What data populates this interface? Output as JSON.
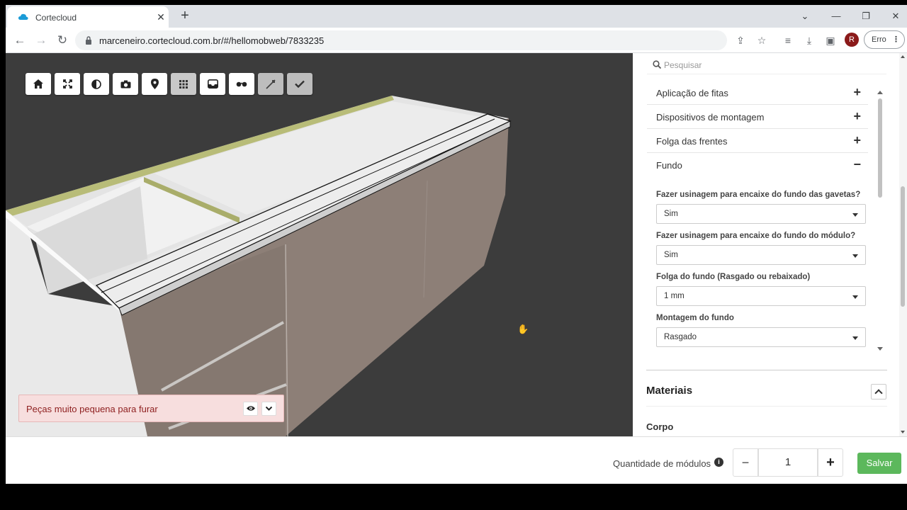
{
  "browser": {
    "tab_title": "Cortecloud",
    "tab_close": "✕",
    "new_tab": "+",
    "url": "marceneiro.cortecloud.com.br/#/hellomobweb/7833235",
    "profile_initial": "R",
    "error_label": "Erro",
    "colors": {
      "tabstrip": "#dee1e6",
      "favicon": "#1a9bd7",
      "profile": "#8b1a1a"
    }
  },
  "viewer": {
    "toolbar": [
      {
        "name": "home-icon"
      },
      {
        "name": "fullscreen-icon"
      },
      {
        "name": "contrast-icon"
      },
      {
        "name": "camera-icon"
      },
      {
        "name": "location-pin-icon"
      },
      {
        "name": "grid-icon"
      },
      {
        "name": "tray-icon"
      },
      {
        "name": "glasses-icon"
      },
      {
        "name": "measure-icon"
      },
      {
        "name": "check-icon"
      }
    ],
    "alert_message": "Peças muito pequena para furar",
    "alert_color": "#f7dede"
  },
  "panel": {
    "search_placeholder": "Pesquisar",
    "accordion": [
      {
        "label": "Aplicação de fitas",
        "state": "+"
      },
      {
        "label": "Dispositivos de montagem",
        "state": "+"
      },
      {
        "label": "Folga das frentes",
        "state": "+"
      },
      {
        "label": "Fundo",
        "state": "−"
      }
    ],
    "fields": [
      {
        "label": "Fazer usinagem para encaixe do fundo das gavetas?",
        "value": "Sim"
      },
      {
        "label": "Fazer usinagem para encaixe do fundo do módulo?",
        "value": "Sim"
      },
      {
        "label": "Folga do fundo (Rasgado ou rebaixado)",
        "value": "1 mm"
      },
      {
        "label": "Montagem do fundo",
        "value": "Rasgado"
      }
    ],
    "materials_title": "Materiais",
    "corpo_label": "Corpo"
  },
  "footer": {
    "quantity_label": "Quantidade de módulos",
    "info": "i",
    "minus": "−",
    "quantity": "1",
    "plus": "+",
    "save_label": "Salvar",
    "save_color": "#5cb85c"
  }
}
